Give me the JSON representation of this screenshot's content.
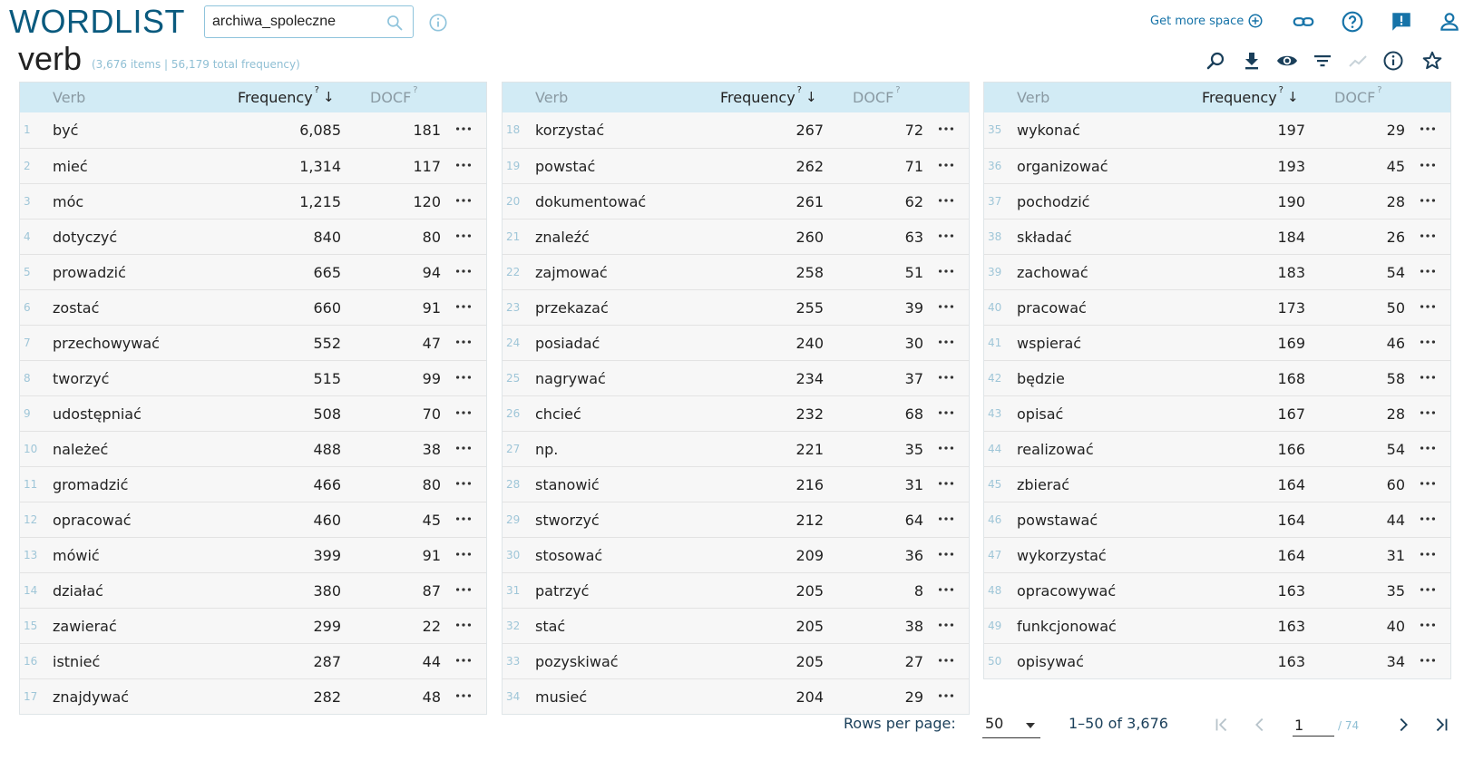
{
  "app": {
    "logo": "WORDLIST",
    "corpus_value": "archiwa_spoleczne",
    "get_more_space": "Get more space"
  },
  "header": {
    "title": "verb",
    "subtitle": "(3,676 items | 56,179 total frequency)"
  },
  "columns": {
    "word": "Verb",
    "frequency": "Frequency",
    "docf": "DOCF",
    "help_mark": "?",
    "sort_arrow": "↓"
  },
  "rows": [
    {
      "n": "1",
      "word": "być",
      "freq": "6,085",
      "docf": "181"
    },
    {
      "n": "2",
      "word": "mieć",
      "freq": "1,314",
      "docf": "117"
    },
    {
      "n": "3",
      "word": "móc",
      "freq": "1,215",
      "docf": "120"
    },
    {
      "n": "4",
      "word": "dotyczyć",
      "freq": "840",
      "docf": "80"
    },
    {
      "n": "5",
      "word": "prowadzić",
      "freq": "665",
      "docf": "94"
    },
    {
      "n": "6",
      "word": "zostać",
      "freq": "660",
      "docf": "91"
    },
    {
      "n": "7",
      "word": "przechowywać",
      "freq": "552",
      "docf": "47"
    },
    {
      "n": "8",
      "word": "tworzyć",
      "freq": "515",
      "docf": "99"
    },
    {
      "n": "9",
      "word": "udostępniać",
      "freq": "508",
      "docf": "70"
    },
    {
      "n": "10",
      "word": "należeć",
      "freq": "488",
      "docf": "38"
    },
    {
      "n": "11",
      "word": "gromadzić",
      "freq": "466",
      "docf": "80"
    },
    {
      "n": "12",
      "word": "opracować",
      "freq": "460",
      "docf": "45"
    },
    {
      "n": "13",
      "word": "mówić",
      "freq": "399",
      "docf": "91"
    },
    {
      "n": "14",
      "word": "działać",
      "freq": "380",
      "docf": "87"
    },
    {
      "n": "15",
      "word": "zawierać",
      "freq": "299",
      "docf": "22"
    },
    {
      "n": "16",
      "word": "istnieć",
      "freq": "287",
      "docf": "44"
    },
    {
      "n": "17",
      "word": "znajdywać",
      "freq": "282",
      "docf": "48"
    },
    {
      "n": "18",
      "word": "korzystać",
      "freq": "267",
      "docf": "72"
    },
    {
      "n": "19",
      "word": "powstać",
      "freq": "262",
      "docf": "71"
    },
    {
      "n": "20",
      "word": "dokumentować",
      "freq": "261",
      "docf": "62"
    },
    {
      "n": "21",
      "word": "znaleźć",
      "freq": "260",
      "docf": "63"
    },
    {
      "n": "22",
      "word": "zajmować",
      "freq": "258",
      "docf": "51"
    },
    {
      "n": "23",
      "word": "przekazać",
      "freq": "255",
      "docf": "39"
    },
    {
      "n": "24",
      "word": "posiadać",
      "freq": "240",
      "docf": "30"
    },
    {
      "n": "25",
      "word": "nagrywać",
      "freq": "234",
      "docf": "37"
    },
    {
      "n": "26",
      "word": "chcieć",
      "freq": "232",
      "docf": "68"
    },
    {
      "n": "27",
      "word": "np.",
      "freq": "221",
      "docf": "35"
    },
    {
      "n": "28",
      "word": "stanowić",
      "freq": "216",
      "docf": "31"
    },
    {
      "n": "29",
      "word": "stworzyć",
      "freq": "212",
      "docf": "64"
    },
    {
      "n": "30",
      "word": "stosować",
      "freq": "209",
      "docf": "36"
    },
    {
      "n": "31",
      "word": "patrzyć",
      "freq": "205",
      "docf": "8"
    },
    {
      "n": "32",
      "word": "stać",
      "freq": "205",
      "docf": "38"
    },
    {
      "n": "33",
      "word": "pozyskiwać",
      "freq": "205",
      "docf": "27"
    },
    {
      "n": "34",
      "word": "musieć",
      "freq": "204",
      "docf": "29"
    },
    {
      "n": "35",
      "word": "wykonać",
      "freq": "197",
      "docf": "29"
    },
    {
      "n": "36",
      "word": "organizować",
      "freq": "193",
      "docf": "45"
    },
    {
      "n": "37",
      "word": "pochodzić",
      "freq": "190",
      "docf": "28"
    },
    {
      "n": "38",
      "word": "składać",
      "freq": "184",
      "docf": "26"
    },
    {
      "n": "39",
      "word": "zachować",
      "freq": "183",
      "docf": "54"
    },
    {
      "n": "40",
      "word": "pracować",
      "freq": "173",
      "docf": "50"
    },
    {
      "n": "41",
      "word": "wspierać",
      "freq": "169",
      "docf": "46"
    },
    {
      "n": "42",
      "word": "będzie",
      "freq": "168",
      "docf": "58"
    },
    {
      "n": "43",
      "word": "opisać",
      "freq": "167",
      "docf": "28"
    },
    {
      "n": "44",
      "word": "realizować",
      "freq": "166",
      "docf": "54"
    },
    {
      "n": "45",
      "word": "zbierać",
      "freq": "164",
      "docf": "60"
    },
    {
      "n": "46",
      "word": "powstawać",
      "freq": "164",
      "docf": "44"
    },
    {
      "n": "47",
      "word": "wykorzystać",
      "freq": "164",
      "docf": "31"
    },
    {
      "n": "48",
      "word": "opracowywać",
      "freq": "163",
      "docf": "35"
    },
    {
      "n": "49",
      "word": "funkcjonować",
      "freq": "163",
      "docf": "40"
    },
    {
      "n": "50",
      "word": "opisywać",
      "freq": "163",
      "docf": "34"
    }
  ],
  "pagination": {
    "rows_per_page_label": "Rows per page:",
    "rows_per_page_value": "50",
    "range_text": "1–50 of 3,676",
    "current_page": "1",
    "total_pages": "/ 74"
  },
  "icons": {
    "top": [
      "add-circle-icon",
      "link-icon",
      "help-icon",
      "feedback-icon",
      "user-icon"
    ],
    "tools": [
      "search-in-results-icon",
      "download-icon",
      "view-icon",
      "filter-icon",
      "chart-icon",
      "info-icon",
      "star-icon"
    ],
    "pagination": [
      "first-page-icon",
      "prev-page-icon",
      "next-page-icon",
      "last-page-icon"
    ]
  },
  "colors": {
    "logo": "#0a5a7e",
    "accent": "#1673a8",
    "header_bg": "#d2ebf5",
    "row_bg": "#f7f7f7",
    "muted": "#8fbfd4"
  }
}
